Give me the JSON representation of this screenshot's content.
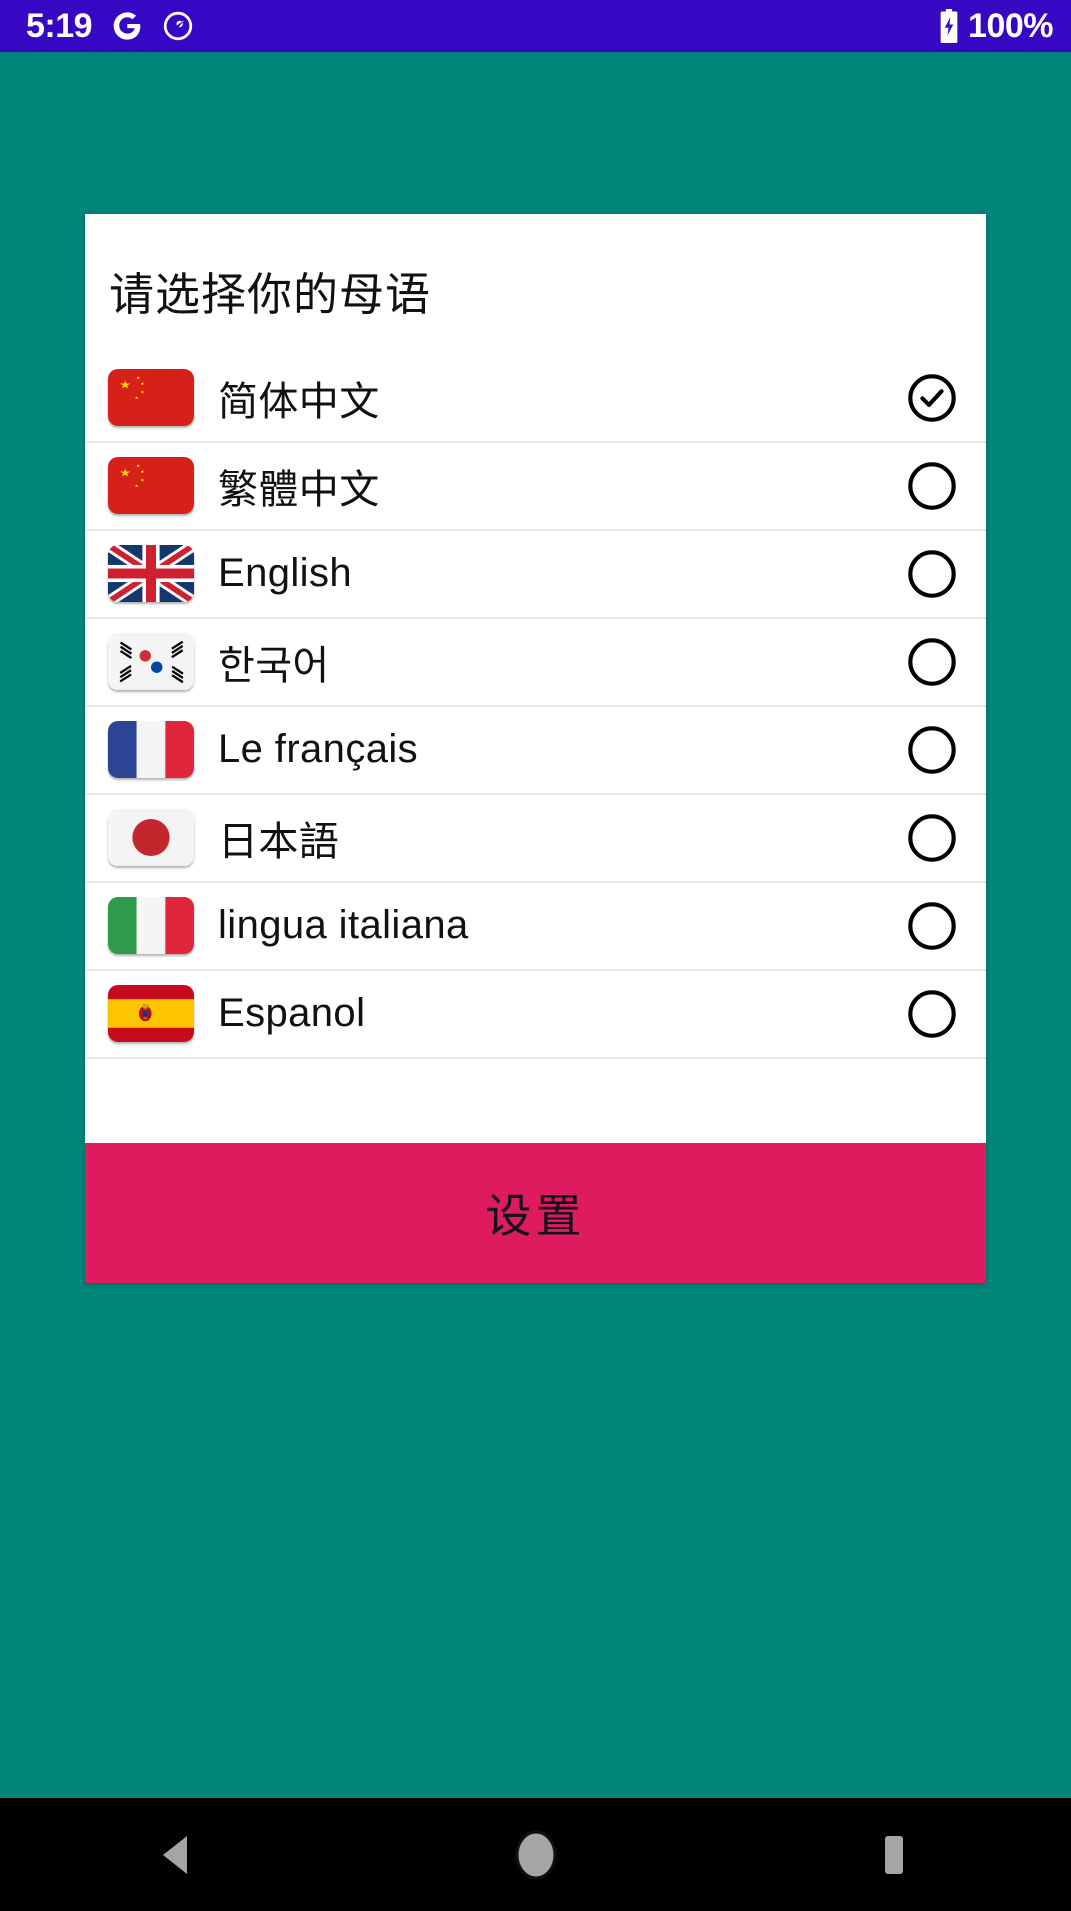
{
  "status_bar": {
    "time": "5:19",
    "battery_percent": "100%",
    "background_color": "#3708C4",
    "icons": [
      "google-g-icon",
      "compass-circle-icon",
      "battery-charging-icon"
    ]
  },
  "theme": {
    "page_background": "#00857B",
    "card_background": "#FFFFFF",
    "button_color": "#DD1B5E",
    "text_color": "#111111",
    "divider_color": "#E8E8E8"
  },
  "dialog": {
    "title": "请选择你的母语",
    "confirm_label": "设置",
    "selected_index": 0,
    "languages": [
      {
        "label": "简体中文",
        "flag": "cn",
        "selected": true
      },
      {
        "label": "繁體中文",
        "flag": "cn",
        "selected": false
      },
      {
        "label": "English",
        "flag": "gb",
        "selected": false
      },
      {
        "label": "한국어",
        "flag": "kr",
        "selected": false
      },
      {
        "label": "Le français",
        "flag": "fr",
        "selected": false
      },
      {
        "label": "日本語",
        "flag": "jp",
        "selected": false
      },
      {
        "label": "lingua italiana",
        "flag": "it",
        "selected": false
      },
      {
        "label": "Espanol",
        "flag": "es",
        "selected": false
      }
    ]
  },
  "nav_bar": {
    "buttons": [
      {
        "name": "back-button",
        "icon": "triangle-left-icon"
      },
      {
        "name": "home-button",
        "icon": "circle-icon"
      },
      {
        "name": "recents-button",
        "icon": "square-icon"
      }
    ]
  }
}
